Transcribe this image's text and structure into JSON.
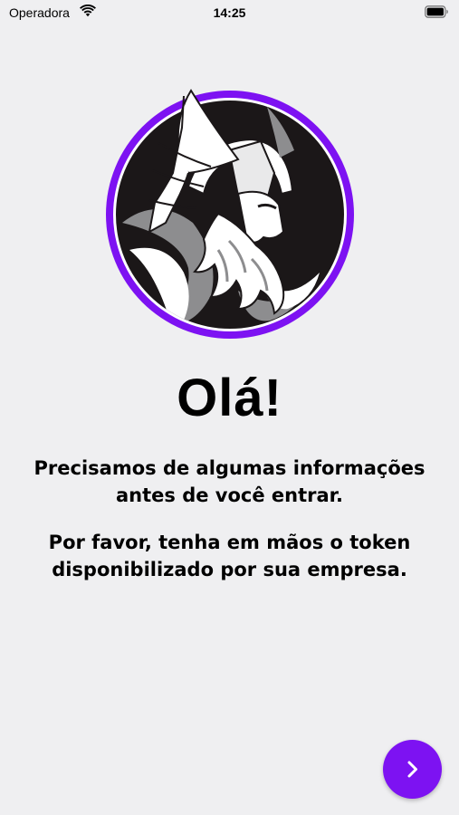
{
  "status_bar": {
    "carrier": "Operadora",
    "time": "14:25",
    "wifi_icon": "wifi-icon",
    "battery_icon": "battery-icon"
  },
  "logo": {
    "icon": "viking-warrior-logo",
    "ring_color": "#7d12f2"
  },
  "main": {
    "title": "Olá!",
    "paragraph_1": "Precisamos de algumas informações antes de você entrar.",
    "paragraph_2": "Por favor, tenha em mãos o token disponibilizado por sua empresa."
  },
  "next_button": {
    "icon": "chevron-right-icon",
    "color": "#7d12f2"
  }
}
